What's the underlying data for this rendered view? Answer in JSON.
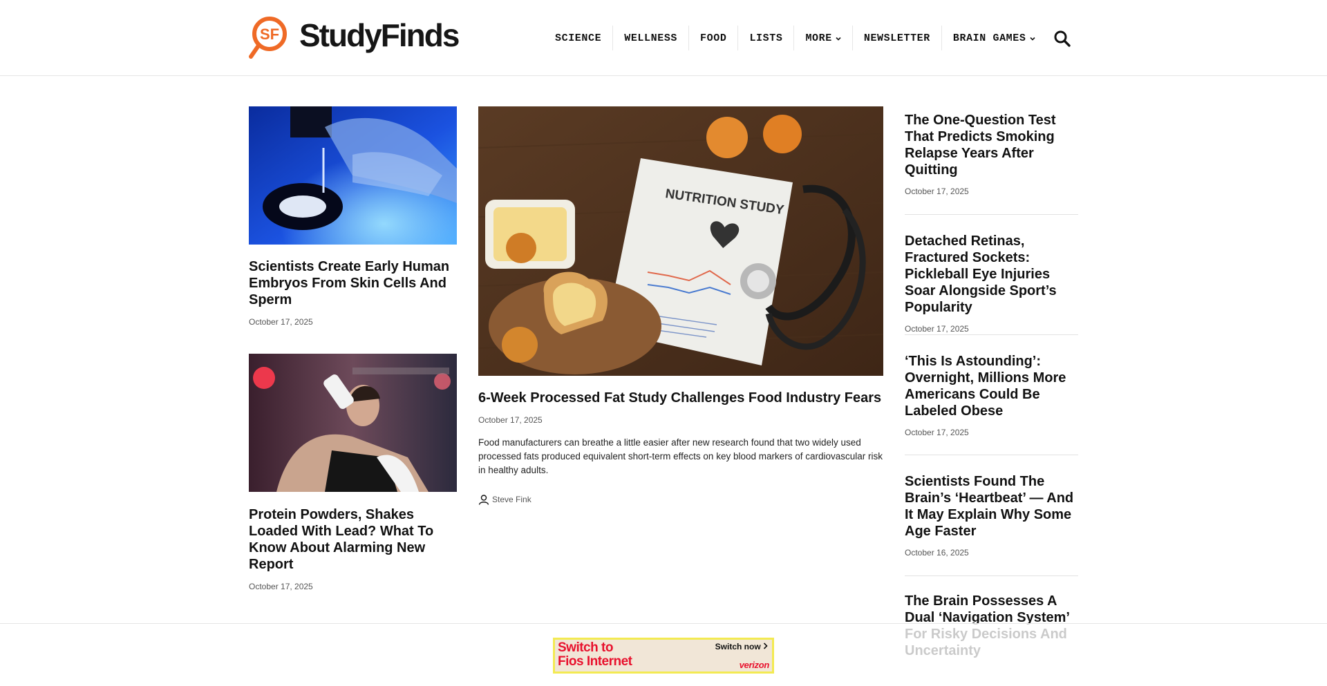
{
  "brand": {
    "name": "StudyFinds",
    "mark": "SF",
    "accent": "#ef6a26"
  },
  "nav": {
    "items": [
      {
        "label": "SCIENCE",
        "dropdown": false
      },
      {
        "label": "WELLNESS",
        "dropdown": false
      },
      {
        "label": "FOOD",
        "dropdown": false
      },
      {
        "label": "LISTS",
        "dropdown": false
      },
      {
        "label": "MORE",
        "dropdown": true
      },
      {
        "label": "NEWSLETTER",
        "dropdown": false
      },
      {
        "label": "BRAIN GAMES",
        "dropdown": true
      }
    ],
    "search_icon": "search-icon"
  },
  "left_column": [
    {
      "title": "Scientists Create Early Human Embryos From Skin Cells And Sperm",
      "date": "October 17, 2025",
      "image": "lab-microscope-photo"
    },
    {
      "title": "Protein Powders, Shakes Loaded With Lead? What To Know About Alarming New Report",
      "date": "October 17, 2025",
      "image": "man-drinking-shake-photo"
    }
  ],
  "featured": {
    "title": "6-Week Processed Fat Study Challenges Food Industry Fears",
    "date": "October 17, 2025",
    "excerpt": "Food manufacturers can breathe a little easier after new research found that two widely used processed fats produced equivalent short-term effects on key blood markers of cardiovascular risk in healthy adults.",
    "author": "Steve Fink",
    "image": "nutrition-study-photo"
  },
  "right_list": [
    {
      "title": "The One-Question Test That Predicts Smoking Relapse Years After Quitting",
      "date": "October 17, 2025"
    },
    {
      "title": "Detached Retinas, Fractured Sockets: Pickleball Eye Injuries Soar Alongside Sport’s Popularity",
      "date": "October 17, 2025"
    },
    {
      "title": "‘This Is Astounding’: Overnight, Millions More Americans Could Be Labeled Obese",
      "date": "October 17, 2025"
    },
    {
      "title": "Scientists Found The Brain’s ‘Heartbeat’ — And It May Explain Why Some Age Faster",
      "date": "October 16, 2025"
    },
    {
      "title": "The Brain Possesses A Dual ‘Navigation System’ For Risky Decisions And Uncertainty",
      "date": ""
    }
  ],
  "ad": {
    "headline_1": "Switch to",
    "headline_2": "Fios Internet",
    "cta": "Switch now",
    "brand": "verizon"
  }
}
